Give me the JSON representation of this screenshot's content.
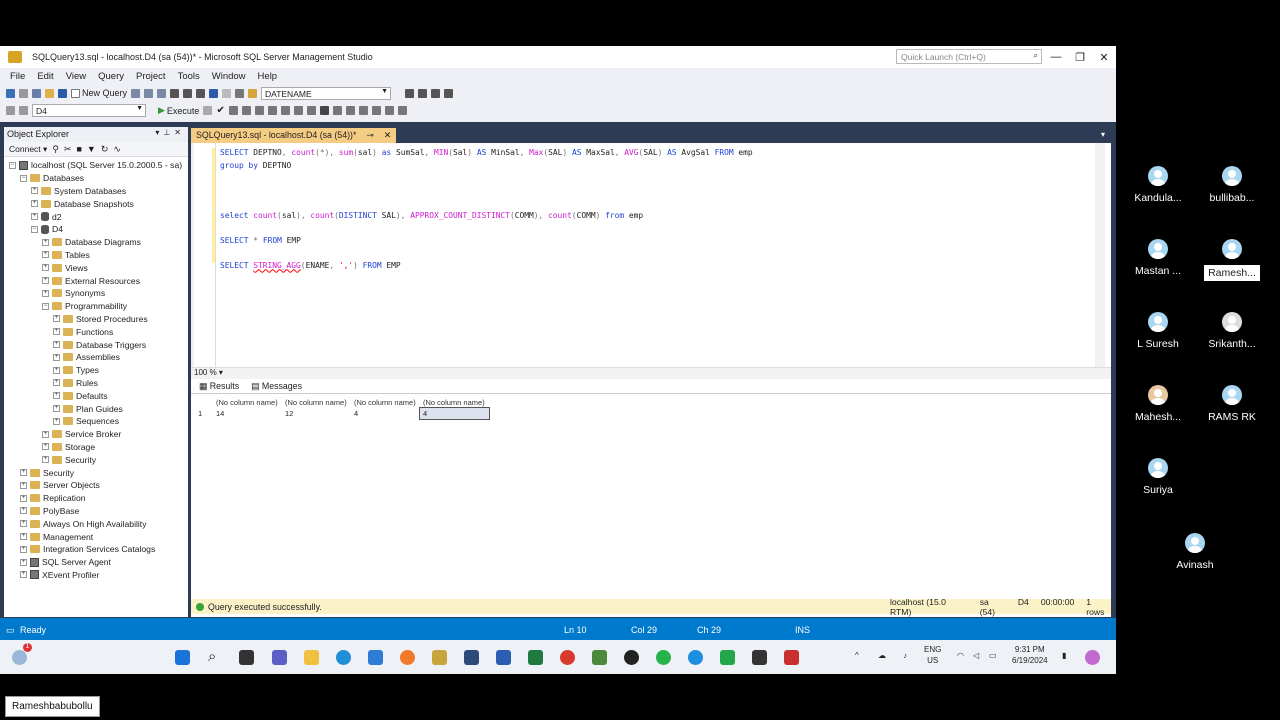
{
  "window": {
    "title": "SQLQuery13.sql - localhost.D4 (sa (54))* - Microsoft SQL Server Management Studio",
    "quick_launch_placeholder": "Quick Launch (Ctrl+Q)"
  },
  "menu": [
    "File",
    "Edit",
    "View",
    "Query",
    "Project",
    "Tools",
    "Window",
    "Help"
  ],
  "toolbar": {
    "new_query": "New Query",
    "execute": "Execute",
    "db_combo": "D4",
    "func_combo": "DATENAME"
  },
  "object_explorer": {
    "title": "Object Explorer",
    "connect": "Connect",
    "nodes": [
      {
        "label": "localhost (SQL Server 15.0.2000.5 - sa)",
        "level": 0,
        "exp": "−",
        "icon": "server"
      },
      {
        "label": "Databases",
        "level": 1,
        "exp": "−",
        "icon": "folder"
      },
      {
        "label": "System Databases",
        "level": 2,
        "exp": "+",
        "icon": "folder"
      },
      {
        "label": "Database Snapshots",
        "level": 2,
        "exp": "+",
        "icon": "folder"
      },
      {
        "label": "d2",
        "level": 2,
        "exp": "+",
        "icon": "db"
      },
      {
        "label": "D4",
        "level": 2,
        "exp": "−",
        "icon": "db"
      },
      {
        "label": "Database Diagrams",
        "level": 3,
        "exp": "+",
        "icon": "folder"
      },
      {
        "label": "Tables",
        "level": 3,
        "exp": "+",
        "icon": "folder"
      },
      {
        "label": "Views",
        "level": 3,
        "exp": "+",
        "icon": "folder"
      },
      {
        "label": "External Resources",
        "level": 3,
        "exp": "+",
        "icon": "folder"
      },
      {
        "label": "Synonyms",
        "level": 3,
        "exp": "+",
        "icon": "folder"
      },
      {
        "label": "Programmability",
        "level": 3,
        "exp": "−",
        "icon": "folder"
      },
      {
        "label": "Stored Procedures",
        "level": 4,
        "exp": "+",
        "icon": "folder"
      },
      {
        "label": "Functions",
        "level": 4,
        "exp": "+",
        "icon": "folder"
      },
      {
        "label": "Database Triggers",
        "level": 4,
        "exp": "+",
        "icon": "folder"
      },
      {
        "label": "Assemblies",
        "level": 4,
        "exp": "+",
        "icon": "folder"
      },
      {
        "label": "Types",
        "level": 4,
        "exp": "+",
        "icon": "folder"
      },
      {
        "label": "Rules",
        "level": 4,
        "exp": "+",
        "icon": "folder"
      },
      {
        "label": "Defaults",
        "level": 4,
        "exp": "+",
        "icon": "folder"
      },
      {
        "label": "Plan Guides",
        "level": 4,
        "exp": "+",
        "icon": "folder"
      },
      {
        "label": "Sequences",
        "level": 4,
        "exp": "+",
        "icon": "folder"
      },
      {
        "label": "Service Broker",
        "level": 3,
        "exp": "+",
        "icon": "folder"
      },
      {
        "label": "Storage",
        "level": 3,
        "exp": "+",
        "icon": "folder"
      },
      {
        "label": "Security",
        "level": 3,
        "exp": "+",
        "icon": "folder"
      },
      {
        "label": "Security",
        "level": 1,
        "exp": "+",
        "icon": "folder"
      },
      {
        "label": "Server Objects",
        "level": 1,
        "exp": "+",
        "icon": "folder"
      },
      {
        "label": "Replication",
        "level": 1,
        "exp": "+",
        "icon": "folder"
      },
      {
        "label": "PolyBase",
        "level": 1,
        "exp": "+",
        "icon": "folder"
      },
      {
        "label": "Always On High Availability",
        "level": 1,
        "exp": "+",
        "icon": "folder"
      },
      {
        "label": "Management",
        "level": 1,
        "exp": "+",
        "icon": "folder"
      },
      {
        "label": "Integration Services Catalogs",
        "level": 1,
        "exp": "+",
        "icon": "folder"
      },
      {
        "label": "SQL Server Agent",
        "level": 1,
        "exp": "+",
        "icon": "agent"
      },
      {
        "label": "XEvent Profiler",
        "level": 1,
        "exp": "+",
        "icon": "xe"
      }
    ]
  },
  "editor": {
    "tab_label": "SQLQuery13.sql - localhost.D4 (sa (54))*",
    "zoom": "100 %",
    "lines": [
      "<span class=\"kw\">SELECT</span> DEPTNO<span class=\"gr\">,</span> <span class=\"fn\">count</span><span class=\"gr\">(*),</span> <span class=\"fn\">sum</span><span class=\"gr\">(</span>sal<span class=\"gr\">)</span> <span class=\"kw\">as</span> SumSal<span class=\"gr\">,</span> <span class=\"fn\">MIN</span><span class=\"gr\">(</span>Sal<span class=\"gr\">)</span> <span class=\"kw\">AS</span> MinSal<span class=\"gr\">,</span> <span class=\"fn\">Max</span><span class=\"gr\">(</span>SAL<span class=\"gr\">)</span> <span class=\"kw\">AS</span> MaxSal<span class=\"gr\">,</span> <span class=\"fn\">AVG</span><span class=\"gr\">(</span>SAL<span class=\"gr\">)</span> <span class=\"kw\">AS</span> AvgSal <span class=\"kw\">FROM</span> emp",
      "<span class=\"kw\">group by</span> DEPTNO",
      "",
      "",
      "",
      "<span class=\"kw\">select</span> <span class=\"fn\">count</span><span class=\"gr\">(</span>sal<span class=\"gr\">),</span> <span class=\"fn\">count</span><span class=\"gr\">(</span><span class=\"kw\">DISTINCT</span> SAL<span class=\"gr\">),</span> <span class=\"fn\">APPROX_COUNT_DISTINCT</span><span class=\"gr\">(</span>COMM<span class=\"gr\">),</span> <span class=\"fn\">count</span><span class=\"gr\">(</span>COMM<span class=\"gr\">)</span> <span class=\"kw\">from</span> emp",
      "",
      "<span class=\"kw\">SELECT</span> <span class=\"gr\">*</span> <span class=\"kw\">FROM</span> EMP",
      "",
      "<span class=\"kw\">SELECT</span> <span class=\"fn\" style=\"text-decoration:underline wavy red\">STRING_AGG</span><span class=\"gr\">(</span>ENAME<span class=\"gr\">,</span> <span class=\"str\">','</span><span class=\"gr\">)</span> <span class=\"kw\">FROM</span> EMP"
    ]
  },
  "results": {
    "tabs": [
      "Results",
      "Messages"
    ],
    "columns": [
      "(No column name)",
      "(No column name)",
      "(No column name)",
      "(No column name)"
    ],
    "rows": [
      [
        "1",
        "14",
        "12",
        "4",
        "4"
      ]
    ]
  },
  "query_status": {
    "message": "Query executed successfully.",
    "server": "localhost (15.0 RTM)",
    "user": "sa (54)",
    "db": "D4",
    "time": "00:00:00",
    "rows": "1 rows"
  },
  "statusbar": {
    "ready": "Ready",
    "ln": "Ln 10",
    "col": "Col 29",
    "ch": "Ch 29",
    "ins": "INS"
  },
  "taskbar": {
    "lang": "ENG",
    "region": "US",
    "time": "9:31 PM",
    "date": "6/19/2024",
    "badge": "1"
  },
  "participants": [
    {
      "name": "Kandula...",
      "type": "avatar"
    },
    {
      "name": "bullibab...",
      "type": "avatar"
    },
    {
      "name": "Mastan ...",
      "type": "avatar"
    },
    {
      "name": "Ramesh...",
      "type": "avatar",
      "active": true
    },
    {
      "name": "L Suresh",
      "type": "avatar"
    },
    {
      "name": "Srikanth...",
      "type": "photo1"
    },
    {
      "name": "Mahesh...",
      "type": "photo2"
    },
    {
      "name": "RAMS RK",
      "type": "avatar"
    },
    {
      "name": "Suriya",
      "type": "avatar"
    },
    {
      "name": "Avinash",
      "type": "avatar"
    }
  ],
  "presenter_name": "Rameshbabubollu"
}
